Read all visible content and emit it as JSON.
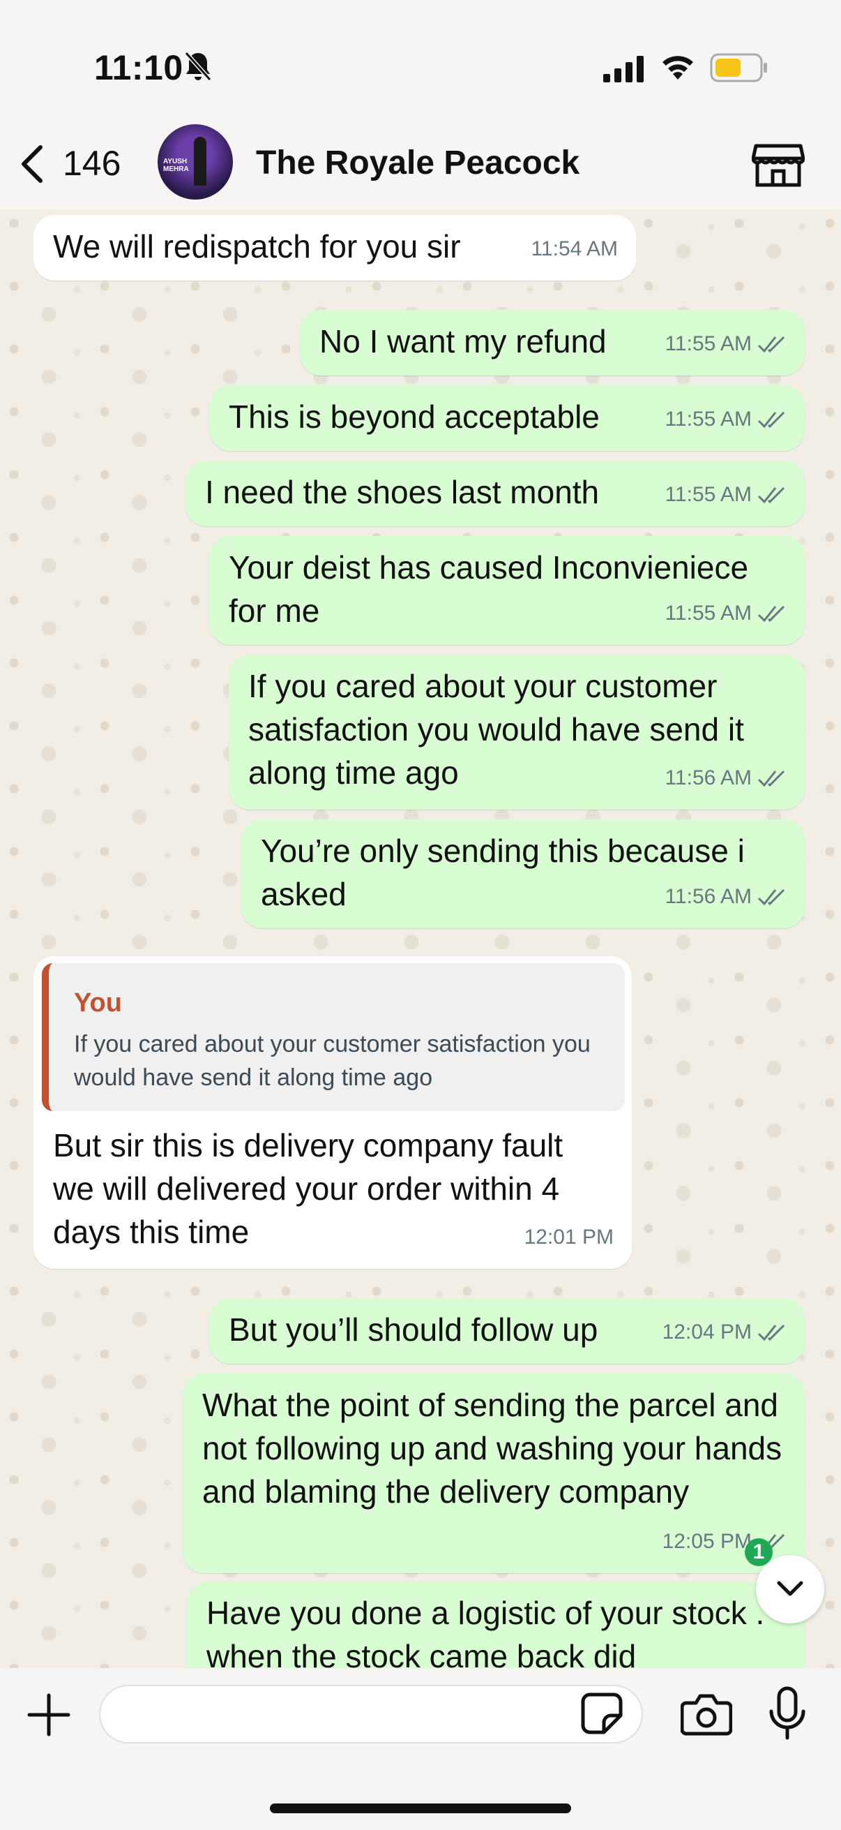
{
  "status_bar": {
    "time": "11:10"
  },
  "header": {
    "back_count": "146",
    "contact_name": "The Royale Peacock",
    "avatar_text": "AYUSH MEHRA"
  },
  "messages": [
    {
      "dir": "in",
      "text": "We will redispatch for you sir",
      "time": "11:54 AM"
    },
    {
      "dir": "out",
      "text": "No I want my refund",
      "time": "11:55 AM"
    },
    {
      "dir": "out",
      "text": "This is beyond acceptable",
      "time": "11:55 AM"
    },
    {
      "dir": "out",
      "text": "I need the shoes last month",
      "time": "11:55 AM"
    },
    {
      "dir": "out",
      "text": "Your deist has caused Inconvieniece for me",
      "time": "11:55 AM"
    },
    {
      "dir": "out",
      "text": "If you cared about your customer satisfaction you would have send it along time ago",
      "time": "11:56 AM"
    },
    {
      "dir": "out",
      "text": "You’re only sending this because i asked",
      "time": "11:56 AM"
    },
    {
      "dir": "in",
      "text": "But sir this is delivery company fault we will delivered your order within 4 days this time",
      "time": "12:01 PM",
      "quote": {
        "author": "You",
        "text": "If you cared about your customer satisfaction you would have send it along time ago"
      }
    },
    {
      "dir": "out",
      "text": "But you’ll should follow up",
      "time": "12:04 PM"
    },
    {
      "dir": "out",
      "text": "What the point of sending the parcel and not following up and washing your hands and blaming the delivery company",
      "time": "12:05 PM"
    },
    {
      "dir": "out",
      "text": "Have you done a logistic of your stock . when the stock came back did",
      "time": ""
    }
  ],
  "scroll": {
    "unread_count": "1"
  },
  "composer": {
    "placeholder": ""
  },
  "colors": {
    "outgoing": "#d9fdd3",
    "incoming": "#ffffff",
    "quote_accent": "#c0522f",
    "badge": "#1fa855"
  }
}
